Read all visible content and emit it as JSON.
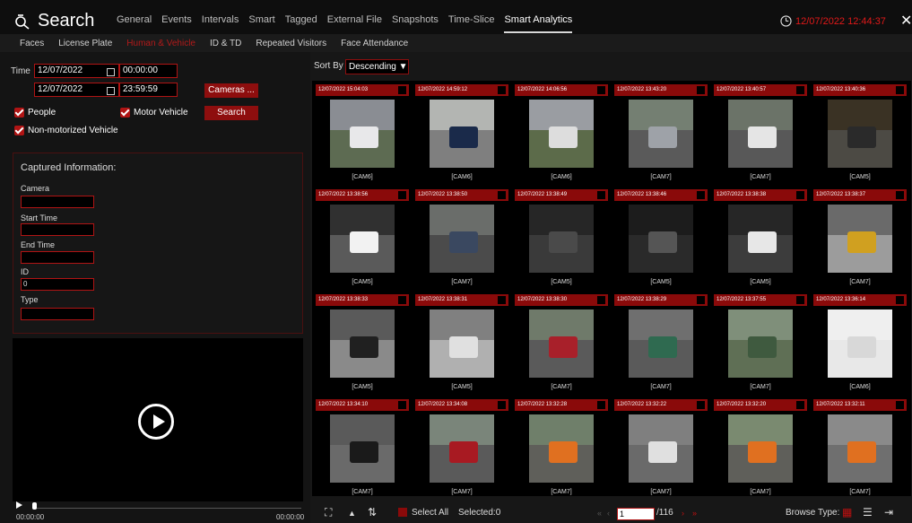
{
  "header": {
    "title": "Search",
    "tabs": [
      "General",
      "Events",
      "Intervals",
      "Smart",
      "Tagged",
      "External File",
      "Snapshots",
      "Time-Slice",
      "Smart Analytics"
    ],
    "active_tab": "Smart Analytics",
    "clock": "12/07/2022 12:44:37"
  },
  "subtabs": {
    "items": [
      "Faces",
      "License Plate",
      "Human & Vehicle",
      "ID & TD",
      "Repeated Visitors",
      "Face Attendance"
    ],
    "active": "Human & Vehicle"
  },
  "filters": {
    "time_label": "Time",
    "start_date": "12/07/2022",
    "start_time": "00:00:00",
    "end_date": "12/07/2022",
    "end_time": "23:59:59",
    "cameras_button": "Cameras ...",
    "search_button": "Search",
    "checkboxes": [
      {
        "label": "People",
        "checked": true
      },
      {
        "label": "Motor Vehicle",
        "checked": true
      },
      {
        "label": "Non-motorized Vehicle",
        "checked": true
      }
    ]
  },
  "captured": {
    "title": "Captured Information:",
    "fields": [
      {
        "label": "Camera",
        "value": ""
      },
      {
        "label": "Start Time",
        "value": ""
      },
      {
        "label": "End Time",
        "value": ""
      },
      {
        "label": "ID",
        "value": "0"
      },
      {
        "label": "Type",
        "value": ""
      }
    ]
  },
  "player": {
    "current": "00:00:00",
    "total": "00:00:00"
  },
  "sort": {
    "label": "Sort By",
    "value": "Descending"
  },
  "results": [
    {
      "ts": "12/07/2022 15:04:03",
      "cam": "[CAM6]"
    },
    {
      "ts": "12/07/2022 14:59:12",
      "cam": "[CAM6]"
    },
    {
      "ts": "12/07/2022 14:06:56",
      "cam": "[CAM6]"
    },
    {
      "ts": "12/07/2022 13:43:20",
      "cam": "[CAM7]"
    },
    {
      "ts": "12/07/2022 13:40:57",
      "cam": "[CAM7]"
    },
    {
      "ts": "12/07/2022 13:40:36",
      "cam": "[CAM5]"
    },
    {
      "ts": "12/07/2022 13:38:56",
      "cam": "[CAM5]"
    },
    {
      "ts": "12/07/2022 13:38:50",
      "cam": "[CAM7]"
    },
    {
      "ts": "12/07/2022 13:38:49",
      "cam": "[CAM5]"
    },
    {
      "ts": "12/07/2022 13:38:46",
      "cam": "[CAM5]"
    },
    {
      "ts": "12/07/2022 13:38:38",
      "cam": "[CAM5]"
    },
    {
      "ts": "12/07/2022 13:38:37",
      "cam": "[CAM7]"
    },
    {
      "ts": "12/07/2022 13:38:33",
      "cam": "[CAM5]"
    },
    {
      "ts": "12/07/2022 13:38:31",
      "cam": "[CAM5]"
    },
    {
      "ts": "12/07/2022 13:38:30",
      "cam": "[CAM7]"
    },
    {
      "ts": "12/07/2022 13:38:29",
      "cam": "[CAM7]"
    },
    {
      "ts": "12/07/2022 13:37:55",
      "cam": "[CAM7]"
    },
    {
      "ts": "12/07/2022 13:36:14",
      "cam": "[CAM6]"
    },
    {
      "ts": "12/07/2022 13:34:10",
      "cam": "[CAM7]"
    },
    {
      "ts": "12/07/2022 13:34:08",
      "cam": "[CAM7]"
    },
    {
      "ts": "12/07/2022 13:32:28",
      "cam": "[CAM7]"
    },
    {
      "ts": "12/07/2022 13:32:22",
      "cam": "[CAM7]"
    },
    {
      "ts": "12/07/2022 13:32:20",
      "cam": "[CAM7]"
    },
    {
      "ts": "12/07/2022 13:32:11",
      "cam": "[CAM7]"
    }
  ],
  "footer": {
    "select_all": "Select All",
    "selected": "Selected:0",
    "page": "1",
    "total_pages": "/116",
    "browse_type": "Browse Type:"
  },
  "colors": {
    "accent": "#b01414",
    "clock": "#e01919"
  }
}
